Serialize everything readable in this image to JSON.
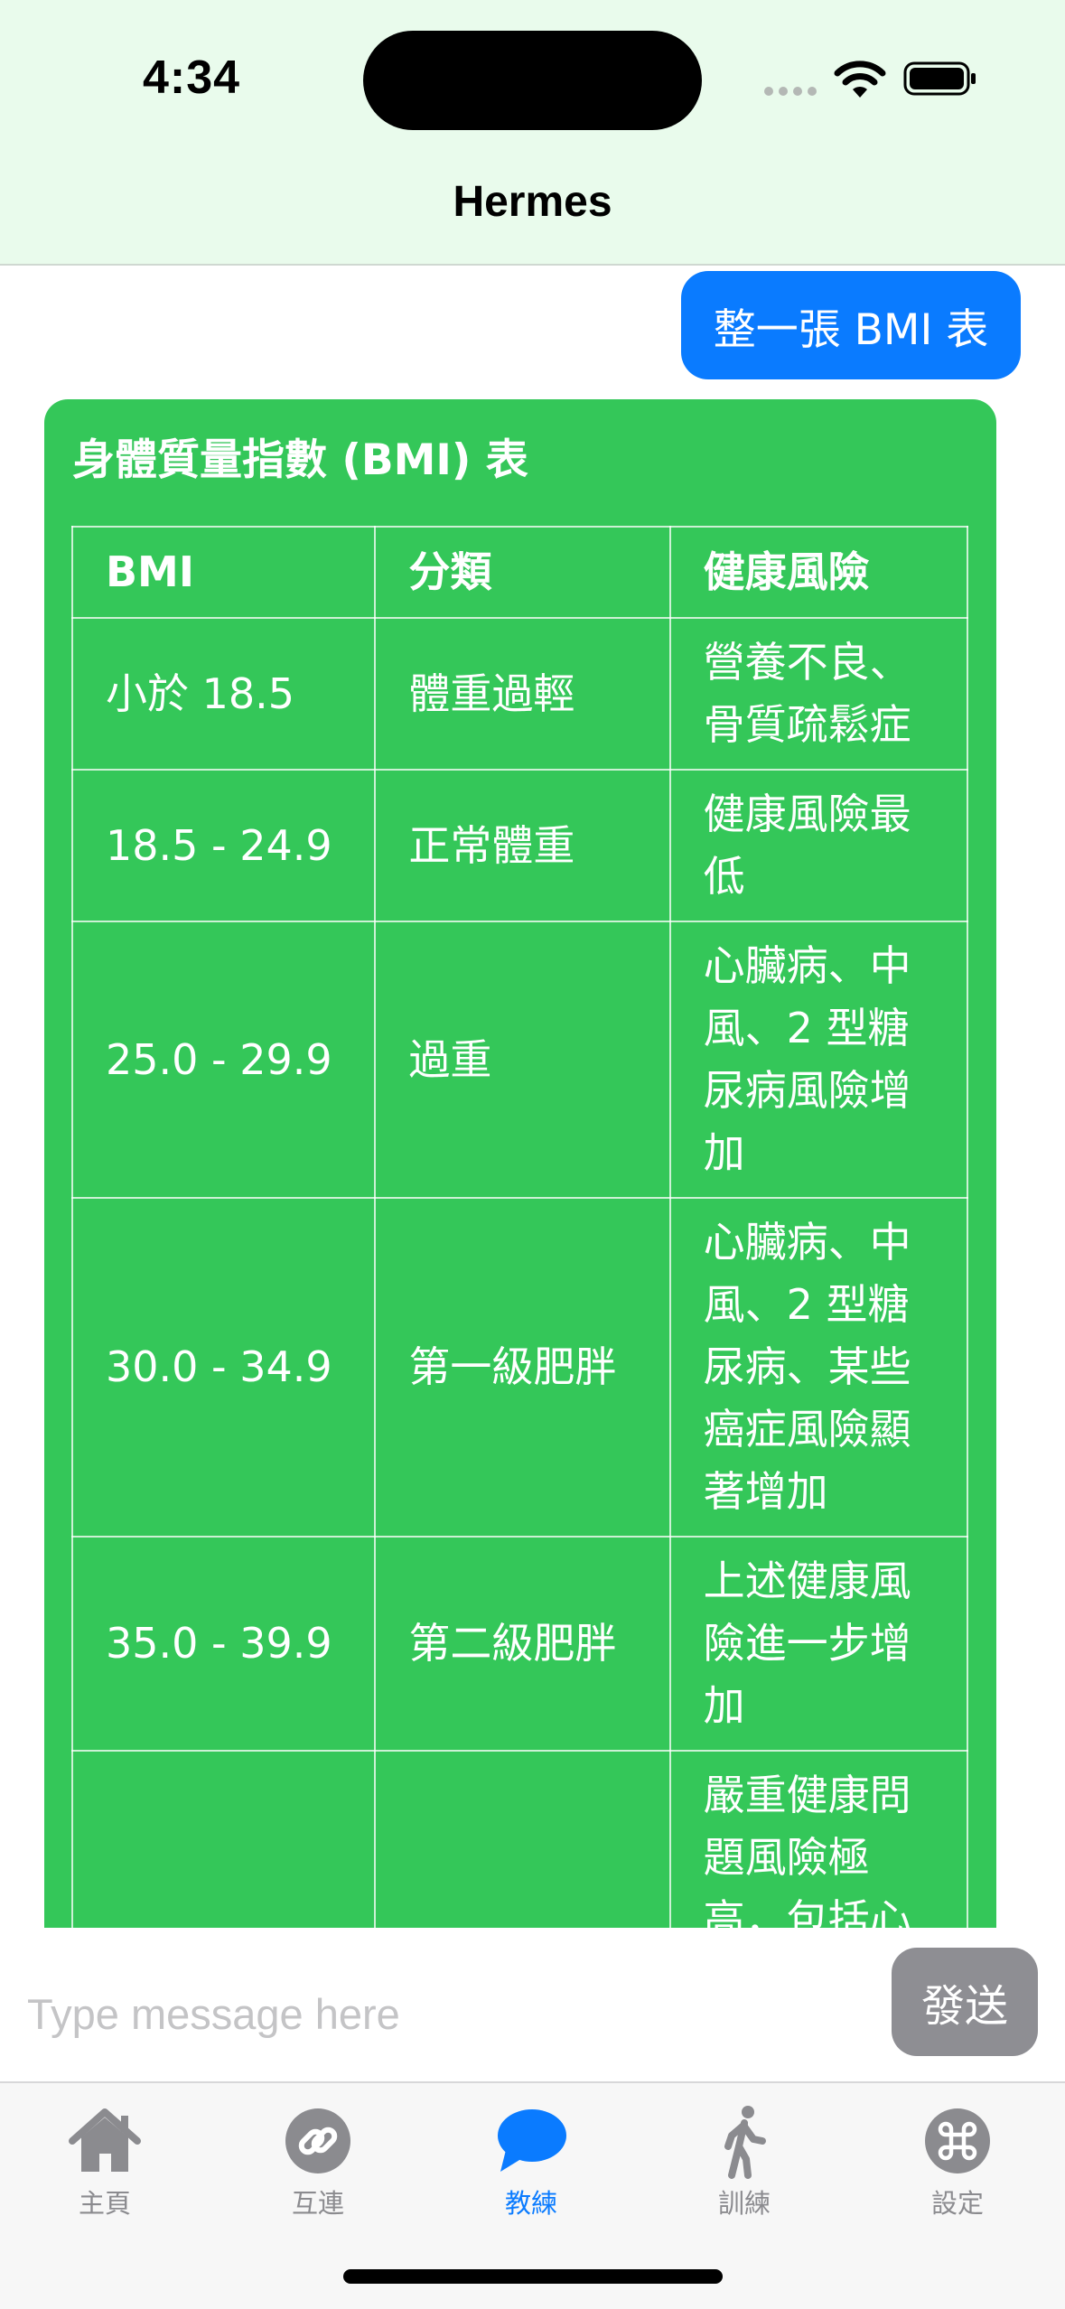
{
  "status_bar": {
    "time": "4:34"
  },
  "nav": {
    "title": "Hermes"
  },
  "chat": {
    "user_message": "整一張 BMI 表",
    "bot_title": "身體質量指數 (BMI) 表",
    "table": {
      "headers": [
        "BMI",
        "分類",
        "健康風險"
      ],
      "rows": [
        {
          "bmi": "小於 18.5",
          "category": "體重過輕",
          "risk": "營養不良、骨質疏鬆症"
        },
        {
          "bmi": "18.5 - 24.9",
          "category": "正常體重",
          "risk": "健康風險最低"
        },
        {
          "bmi": "25.0 - 29.9",
          "category": "過重",
          "risk": "心臟病、中風、2 型糖尿病風險增加"
        },
        {
          "bmi": "30.0 - 34.9",
          "category": "第一級肥胖",
          "risk": "心臟病、中風、2 型糖尿病、某些癌症風險顯著增加"
        },
        {
          "bmi": "35.0 - 39.9",
          "category": "第二級肥胖",
          "risk": "上述健康風險進一步增加"
        },
        {
          "bmi": "",
          "category": "",
          "risk": "嚴重健康問題風險極高，包括心"
        }
      ]
    }
  },
  "input": {
    "placeholder": "Type message here",
    "send_label": "發送"
  },
  "tabs": [
    {
      "label": "主頁",
      "icon": "home-icon"
    },
    {
      "label": "互連",
      "icon": "link-icon"
    },
    {
      "label": "教練",
      "icon": "chat-bubble-icon",
      "active": true
    },
    {
      "label": "訓練",
      "icon": "walking-figure-icon"
    },
    {
      "label": "設定",
      "icon": "command-icon"
    }
  ],
  "colors": {
    "accent": "#0a7bff",
    "bot_bubble": "#34c759",
    "header_bg": "#e9fbec",
    "send_button": "#8e8e93"
  }
}
